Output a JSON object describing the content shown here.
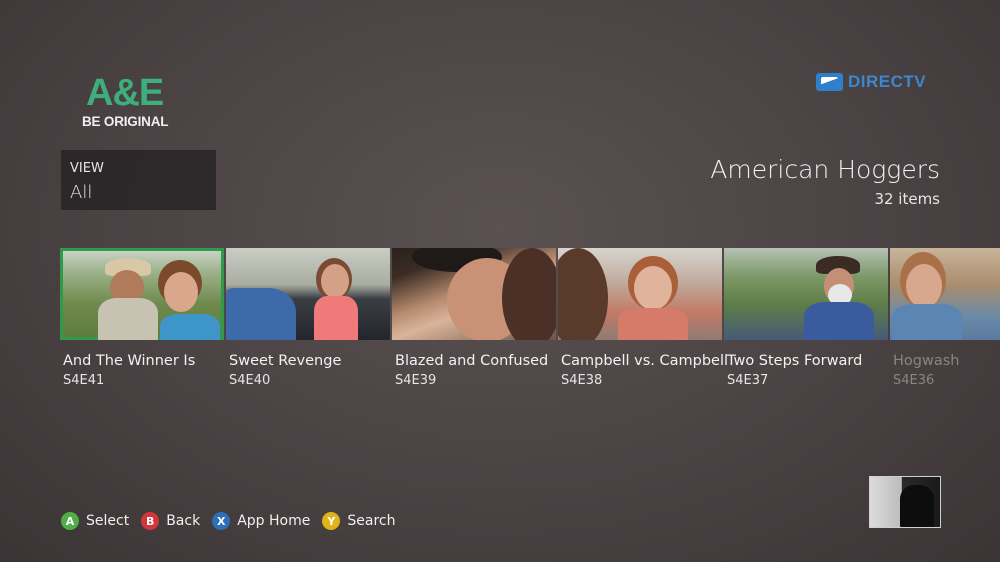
{
  "brand": {
    "logo_main": "A&E",
    "logo_tagline": "BE ORIGINAL",
    "provider": "DIRECTV",
    "colors": {
      "ae_green": "#3fae7d",
      "provider_blue": "#3d87d0"
    }
  },
  "view": {
    "label": "VIEW",
    "value": "All"
  },
  "show": {
    "title": "American Hoggers",
    "count": "32 items"
  },
  "episodes": [
    {
      "title": "And The Winner Is",
      "code": "S4E41",
      "selected": true
    },
    {
      "title": "Sweet Revenge",
      "code": "S4E40",
      "selected": false
    },
    {
      "title": "Blazed and Confused",
      "code": "S4E39",
      "selected": false
    },
    {
      "title": "Campbell vs. Campbell",
      "code": "S4E38",
      "selected": false
    },
    {
      "title": "Two Steps Forward",
      "code": "S4E37",
      "selected": false
    },
    {
      "title": "Hogwash",
      "code": "S4E36",
      "selected": false
    }
  ],
  "controls": [
    {
      "key": "A",
      "label": "Select",
      "color": "#4fae47"
    },
    {
      "key": "B",
      "label": "Back",
      "color": "#d1373a"
    },
    {
      "key": "X",
      "label": "App Home",
      "color": "#2f6fb8"
    },
    {
      "key": "Y",
      "label": "Search",
      "color": "#e2b21b"
    }
  ]
}
